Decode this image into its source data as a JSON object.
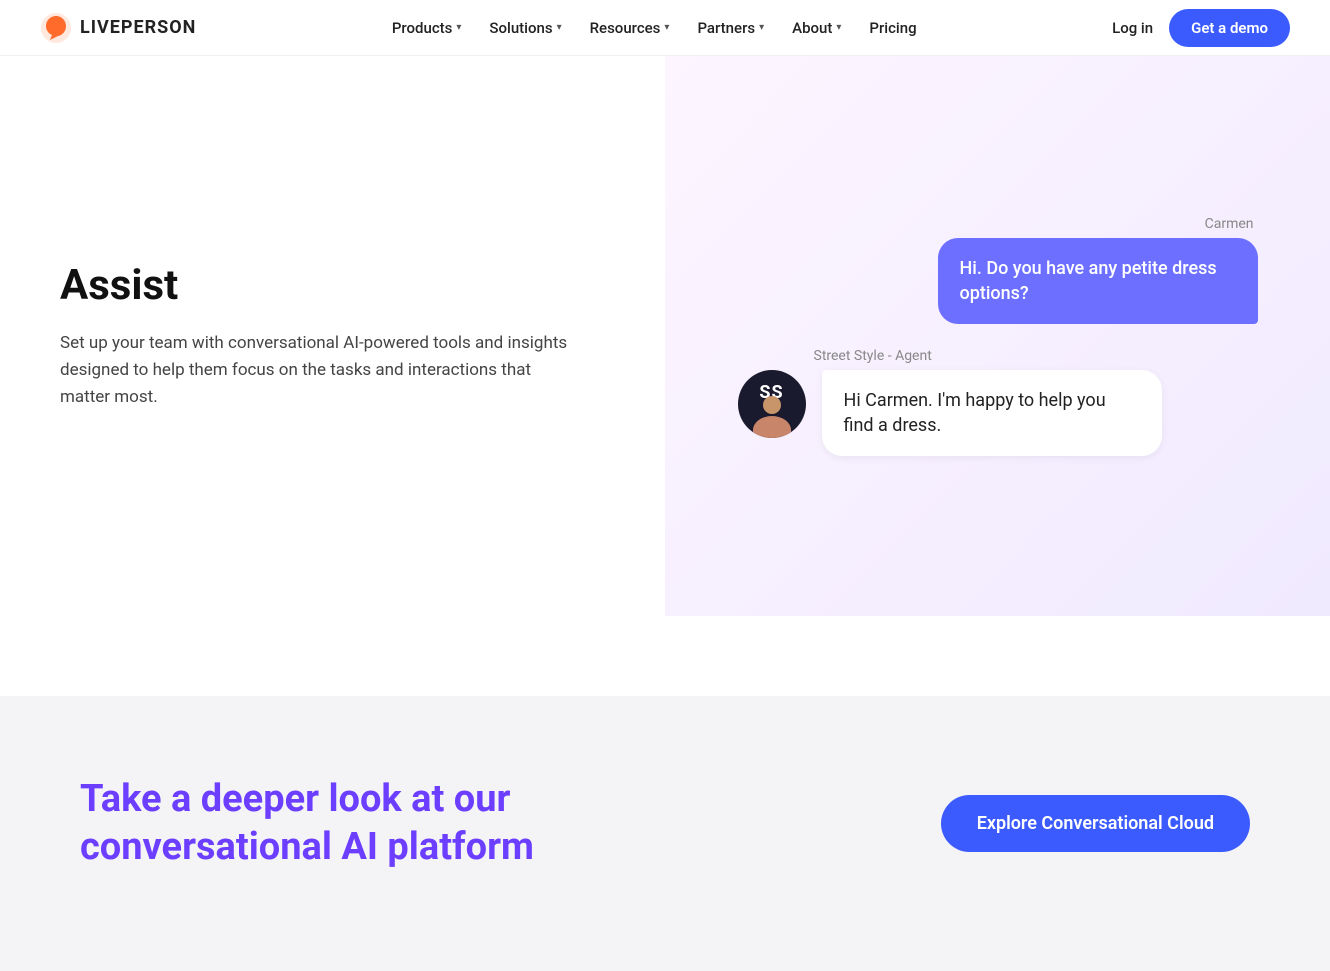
{
  "nav": {
    "logo_text": "LIVEPERSON",
    "links": [
      {
        "label": "Products",
        "has_dropdown": true
      },
      {
        "label": "Solutions",
        "has_dropdown": true
      },
      {
        "label": "Resources",
        "has_dropdown": true
      },
      {
        "label": "Partners",
        "has_dropdown": true
      },
      {
        "label": "About",
        "has_dropdown": true
      },
      {
        "label": "Pricing",
        "has_dropdown": false
      }
    ],
    "login_label": "Log in",
    "demo_label": "Get a demo"
  },
  "hero": {
    "title": "Assist",
    "description": "Set up your team with conversational AI-powered tools and insights designed to help them focus on the tasks and interactions that matter most."
  },
  "chat": {
    "user_name": "Carmen",
    "user_message": "Hi. Do you have any petite dress options?",
    "agent_name": "Street Style - Agent",
    "agent_message": "Hi Carmen. I'm happy to help you find a dress.",
    "avatar_initials": "SS"
  },
  "cta": {
    "heading": "Take a deeper look at our conversational AI platform",
    "button_label": "Explore Conversational Cloud"
  }
}
